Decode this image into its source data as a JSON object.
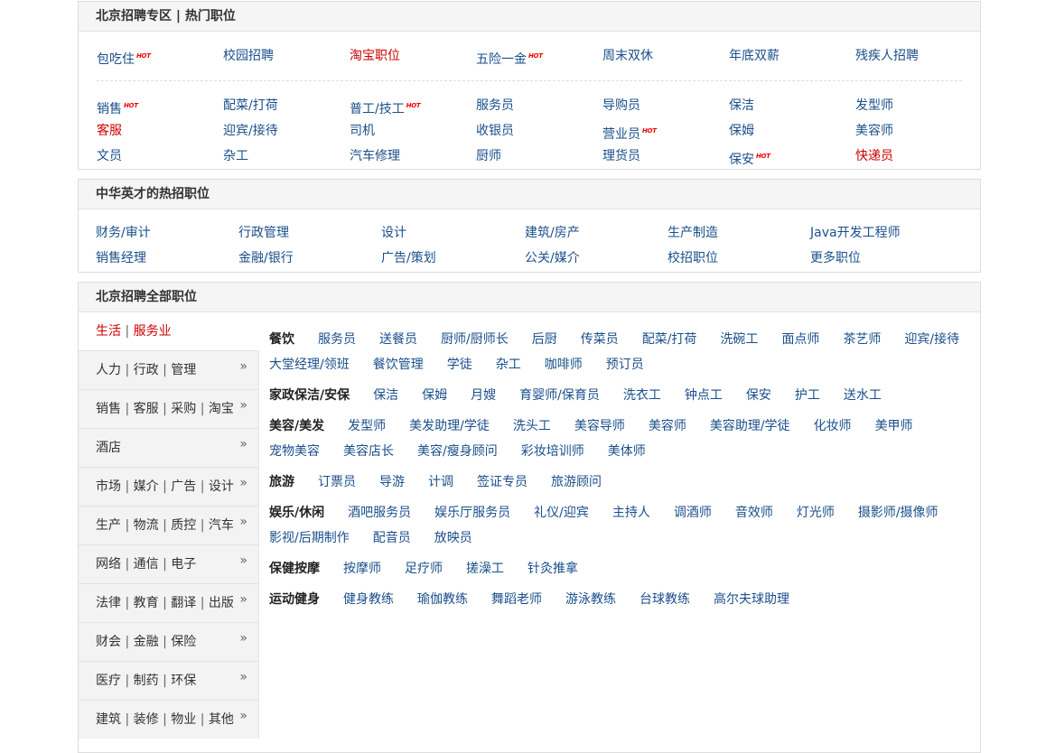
{
  "hot": {
    "title": "北京招聘专区 | 热门职位",
    "hot_badge": "HOT",
    "row1": [
      {
        "label": "包吃住",
        "hot": true,
        "red": false
      },
      {
        "label": "校园招聘",
        "hot": false,
        "red": false
      },
      {
        "label": "淘宝职位",
        "hot": false,
        "red": true
      },
      {
        "label": "五险一金",
        "hot": true,
        "red": false
      },
      {
        "label": "周末双休",
        "hot": false,
        "red": false
      },
      {
        "label": "年底双薪",
        "hot": false,
        "red": false
      },
      {
        "label": "残疾人招聘",
        "hot": false,
        "red": false
      }
    ],
    "rows": [
      [
        {
          "label": "销售",
          "hot": true,
          "red": false
        },
        {
          "label": "配菜/打荷",
          "hot": false,
          "red": false
        },
        {
          "label": "普工/技工",
          "hot": true,
          "red": false
        },
        {
          "label": "服务员",
          "hot": false,
          "red": false
        },
        {
          "label": "导购员",
          "hot": false,
          "red": false
        },
        {
          "label": "保洁",
          "hot": false,
          "red": false
        },
        {
          "label": "发型师",
          "hot": false,
          "red": false
        }
      ],
      [
        {
          "label": "客服",
          "hot": false,
          "red": true
        },
        {
          "label": "迎宾/接待",
          "hot": false,
          "red": false
        },
        {
          "label": "司机",
          "hot": false,
          "red": false
        },
        {
          "label": "收银员",
          "hot": false,
          "red": false
        },
        {
          "label": "营业员",
          "hot": true,
          "red": false
        },
        {
          "label": "保姆",
          "hot": false,
          "red": false
        },
        {
          "label": "美容师",
          "hot": false,
          "red": false
        }
      ],
      [
        {
          "label": "文员",
          "hot": false,
          "red": false
        },
        {
          "label": "杂工",
          "hot": false,
          "red": false
        },
        {
          "label": "汽车修理",
          "hot": false,
          "red": false
        },
        {
          "label": "厨师",
          "hot": false,
          "red": false
        },
        {
          "label": "理货员",
          "hot": false,
          "red": false
        },
        {
          "label": "保安",
          "hot": true,
          "red": false
        },
        {
          "label": "快递员",
          "hot": false,
          "red": true
        }
      ]
    ]
  },
  "zhonghua": {
    "title": "中华英才的热招职位",
    "rows": [
      [
        "财务/审计",
        "行政管理",
        "设计",
        "建筑/房产",
        "生产制造",
        "Java开发工程师"
      ],
      [
        "销售经理",
        "金融/银行",
        "广告/策划",
        "公关/媒介",
        "校招职位",
        "更多职位"
      ]
    ]
  },
  "all": {
    "title": "北京招聘全部职位",
    "side": [
      [
        "生活",
        "服务业"
      ],
      [
        "人力",
        "行政",
        "管理"
      ],
      [
        "销售",
        "客服",
        "采购",
        "淘宝"
      ],
      [
        "酒店"
      ],
      [
        "市场",
        "媒介",
        "广告",
        "设计"
      ],
      [
        "生产",
        "物流",
        "质控",
        "汽车"
      ],
      [
        "网络",
        "通信",
        "电子"
      ],
      [
        "法律",
        "教育",
        "翻译",
        "出版"
      ],
      [
        "财会",
        "金融",
        "保险"
      ],
      [
        "医疗",
        "制药",
        "环保"
      ],
      [
        "建筑",
        "装修",
        "物业",
        "其他"
      ]
    ],
    "separator": "|",
    "chevron": "»",
    "categories": [
      {
        "label": "餐饮",
        "lines": [
          [
            "服务员",
            "送餐员",
            "厨师/厨师长",
            "后厨",
            "传菜员",
            "配菜/打荷",
            "洗碗工",
            "面点师",
            "茶艺师",
            "迎宾/接待"
          ],
          [
            "大堂经理/领班",
            "餐饮管理",
            "学徒",
            "杂工",
            "咖啡师",
            "预订员"
          ]
        ]
      },
      {
        "label": "家政保洁/安保",
        "lines": [
          [
            "保洁",
            "保姆",
            "月嫂",
            "育婴师/保育员",
            "洗衣工",
            "钟点工",
            "保安",
            "护工",
            "送水工"
          ]
        ]
      },
      {
        "label": "美容/美发",
        "lines": [
          [
            "发型师",
            "美发助理/学徒",
            "洗头工",
            "美容导师",
            "美容师",
            "美容助理/学徒",
            "化妆师",
            "美甲师"
          ],
          [
            "宠物美容",
            "美容店长",
            "美容/瘦身顾问",
            "彩妆培训师",
            "美体师"
          ]
        ]
      },
      {
        "label": "旅游",
        "lines": [
          [
            "订票员",
            "导游",
            "计调",
            "签证专员",
            "旅游顾问"
          ]
        ]
      },
      {
        "label": "娱乐/休闲",
        "lines": [
          [
            "酒吧服务员",
            "娱乐厅服务员",
            "礼仪/迎宾",
            "主持人",
            "调酒师",
            "音效师",
            "灯光师",
            "摄影师/摄像师"
          ],
          [
            "影视/后期制作",
            "配音员",
            "放映员"
          ]
        ]
      },
      {
        "label": "保健按摩",
        "lines": [
          [
            "按摩师",
            "足疗师",
            "搓澡工",
            "针灸推拿"
          ]
        ]
      },
      {
        "label": "运动健身",
        "lines": [
          [
            "健身教练",
            "瑜伽教练",
            "舞蹈老师",
            "游泳教练",
            "台球教练",
            "高尔夫球助理"
          ]
        ]
      }
    ]
  }
}
